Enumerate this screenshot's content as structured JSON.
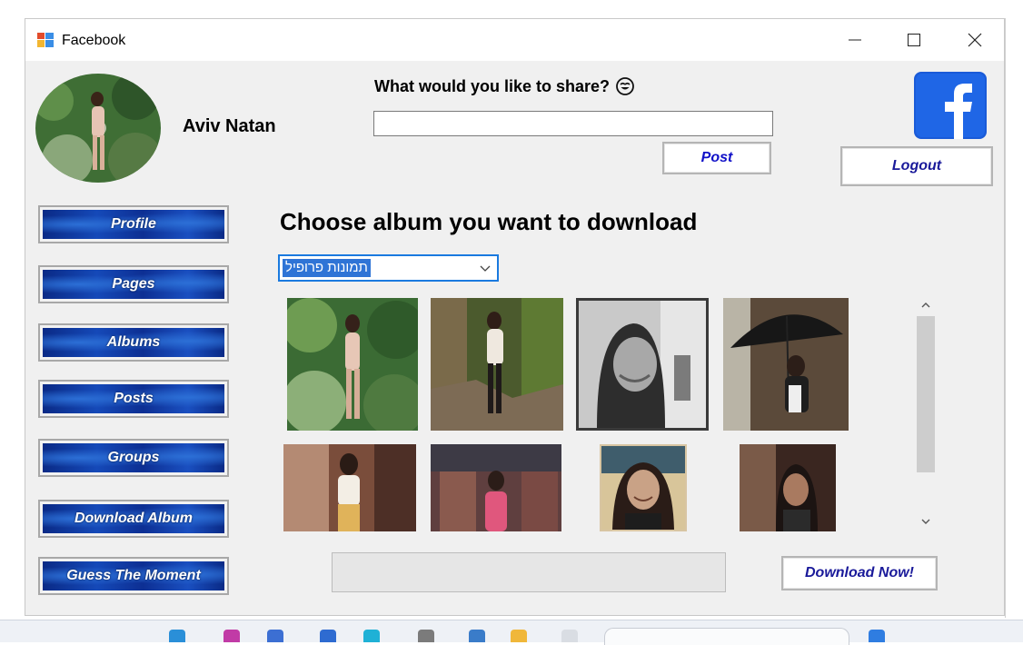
{
  "window": {
    "title": "Facebook"
  },
  "user": {
    "name": "Aviv Natan"
  },
  "share": {
    "prompt": "What would you like to share?",
    "input_value": "",
    "post_label": "Post"
  },
  "logout_label": "Logout",
  "nav": [
    {
      "label": "Profile"
    },
    {
      "label": "Pages"
    },
    {
      "label": "Albums"
    },
    {
      "label": "Posts"
    },
    {
      "label": "Groups"
    },
    {
      "label": "Download Album"
    },
    {
      "label": "Guess The Moment"
    }
  ],
  "album": {
    "heading": "Choose album you want to download",
    "selected": "תמונות פרופיל",
    "download_label": "Download Now!",
    "progress": 0
  },
  "colors": {
    "accent_text": "#1010c8",
    "nav_blue": "#0d2f93",
    "facebook_blue": "#1877f2",
    "select_highlight": "#2f74d6"
  },
  "icons": [
    "app-icon",
    "minimize-icon",
    "maximize-icon",
    "close-icon",
    "emoji-icon",
    "facebook-logo-icon",
    "chevron-down-icon",
    "scroll-up-icon",
    "scroll-down-icon"
  ]
}
